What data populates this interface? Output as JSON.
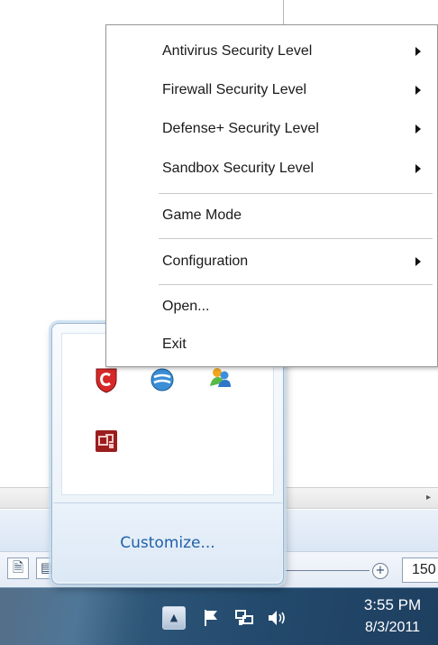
{
  "context_menu": {
    "items": [
      {
        "label": "Antivirus Security Level",
        "submenu": true
      },
      {
        "label": "Firewall Security Level",
        "submenu": true
      },
      {
        "label": "Defense+ Security Level",
        "submenu": true
      },
      {
        "label": "Sandbox Security Level",
        "submenu": true
      },
      {
        "label": "Game Mode",
        "submenu": false
      },
      {
        "label": "Configuration",
        "submenu": true
      },
      {
        "label": "Open...",
        "submenu": false
      },
      {
        "label": "Exit",
        "submenu": false
      }
    ]
  },
  "tray_flyout": {
    "icons": [
      "comodo-shield-icon",
      "network-globe-icon",
      "messenger-icon",
      "tool-app-icon"
    ],
    "customize_label": "Customize..."
  },
  "status_bar": {
    "zoom_value": "150"
  },
  "taskbar": {
    "clock_time": "3:55 PM",
    "clock_date": "8/3/2011",
    "tray_icons": [
      "show-hidden-icons",
      "action-center-flag-icon",
      "network-icon",
      "volume-icon"
    ]
  },
  "colors": {
    "taskbar": "#23496c",
    "link": "#1f60a8",
    "comodo_red": "#d62828"
  }
}
